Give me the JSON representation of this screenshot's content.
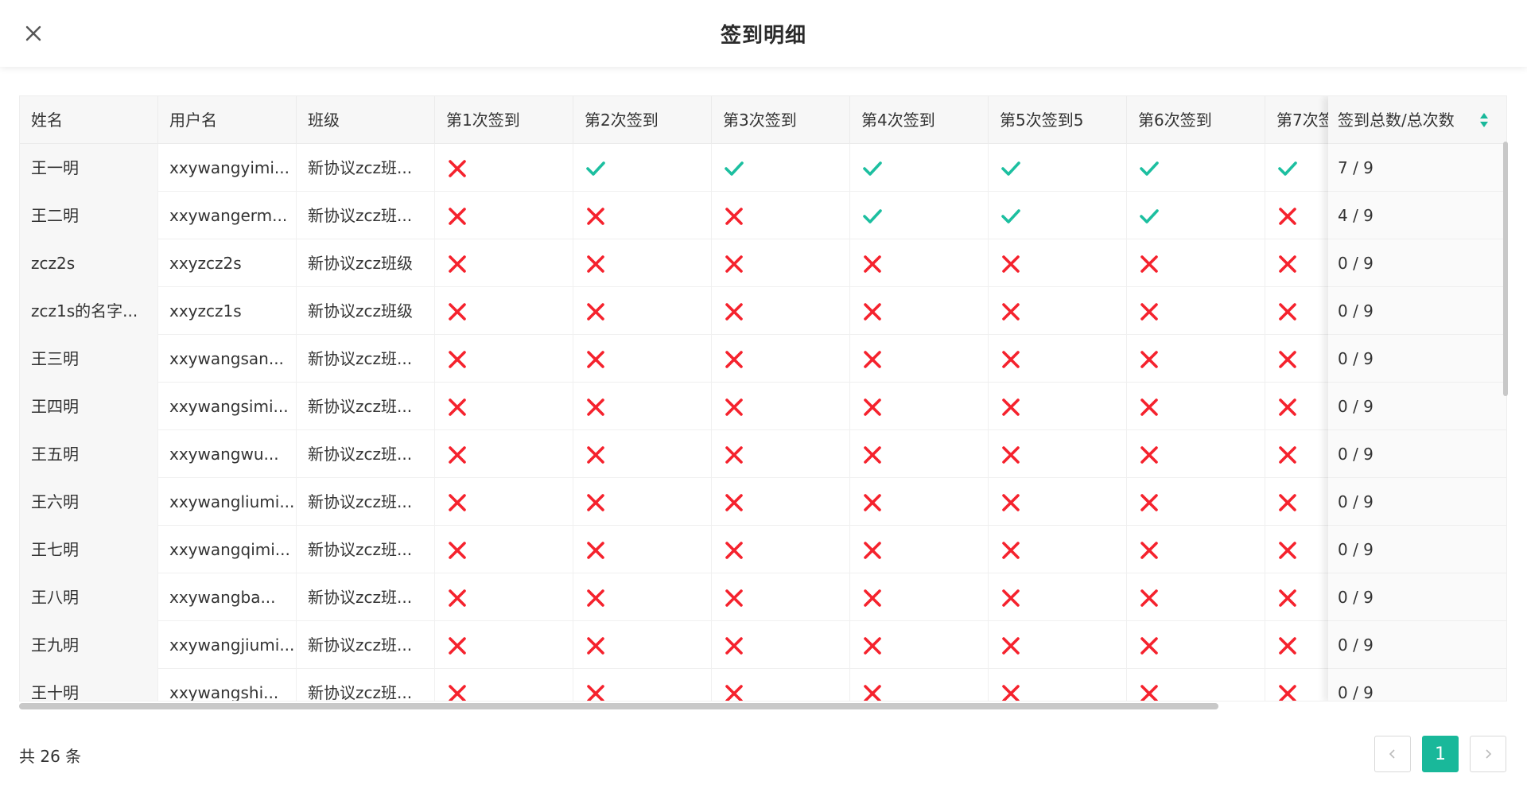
{
  "header": {
    "title": "签到明细",
    "close_icon": "close-icon"
  },
  "table": {
    "columns": [
      "姓名",
      "用户名",
      "班级",
      "第1次签到",
      "第2次签到",
      "第3次签到",
      "第4次签到",
      "第5次签到5",
      "第6次签到",
      "第7次签"
    ],
    "summary_column": {
      "label": "签到总数/总次数",
      "sort_icon": "sort-icon"
    },
    "rows": [
      {
        "name": "王一明",
        "username": "xxywangyimi...",
        "class": "新协议zcz班...",
        "checks": [
          false,
          true,
          true,
          true,
          true,
          true,
          true
        ],
        "summary": "7 / 9"
      },
      {
        "name": "王二明",
        "username": "xxywangerm...",
        "class": "新协议zcz班...",
        "checks": [
          false,
          false,
          false,
          true,
          true,
          true,
          false
        ],
        "summary": "4 / 9"
      },
      {
        "name": "zcz2s",
        "username": "xxyzcz2s",
        "class": "新协议zcz班级",
        "checks": [
          false,
          false,
          false,
          false,
          false,
          false,
          false
        ],
        "summary": "0 / 9"
      },
      {
        "name": "zcz1s的名字...",
        "username": "xxyzcz1s",
        "class": "新协议zcz班级",
        "checks": [
          false,
          false,
          false,
          false,
          false,
          false,
          false
        ],
        "summary": "0 / 9"
      },
      {
        "name": "王三明",
        "username": "xxywangsan...",
        "class": "新协议zcz班...",
        "checks": [
          false,
          false,
          false,
          false,
          false,
          false,
          false
        ],
        "summary": "0 / 9"
      },
      {
        "name": "王四明",
        "username": "xxywangsimi...",
        "class": "新协议zcz班...",
        "checks": [
          false,
          false,
          false,
          false,
          false,
          false,
          false
        ],
        "summary": "0 / 9"
      },
      {
        "name": "王五明",
        "username": "xxywangwu...",
        "class": "新协议zcz班...",
        "checks": [
          false,
          false,
          false,
          false,
          false,
          false,
          false
        ],
        "summary": "0 / 9"
      },
      {
        "name": "王六明",
        "username": "xxywangliumi...",
        "class": "新协议zcz班...",
        "checks": [
          false,
          false,
          false,
          false,
          false,
          false,
          false
        ],
        "summary": "0 / 9"
      },
      {
        "name": "王七明",
        "username": "xxywangqimi...",
        "class": "新协议zcz班...",
        "checks": [
          false,
          false,
          false,
          false,
          false,
          false,
          false
        ],
        "summary": "0 / 9"
      },
      {
        "name": "王八明",
        "username": "xxywangba...",
        "class": "新协议zcz班...",
        "checks": [
          false,
          false,
          false,
          false,
          false,
          false,
          false
        ],
        "summary": "0 / 9"
      },
      {
        "name": "王九明",
        "username": "xxywangjiumi...",
        "class": "新协议zcz班...",
        "checks": [
          false,
          false,
          false,
          false,
          false,
          false,
          false
        ],
        "summary": "0 / 9"
      },
      {
        "name": "王十明",
        "username": "xxywangshi...",
        "class": "新协议zcz班...",
        "checks": [
          false,
          false,
          false,
          false,
          false,
          false,
          false
        ],
        "summary": "0 / 9"
      }
    ]
  },
  "footer": {
    "total_label": "共 26 条",
    "pagination": {
      "prev_icon": "chevron-left-icon",
      "current_page": "1",
      "next_icon": "chevron-right-icon"
    }
  },
  "colors": {
    "accent": "#19b89a",
    "check": "#1cbfa0",
    "cross": "#f5222d"
  }
}
